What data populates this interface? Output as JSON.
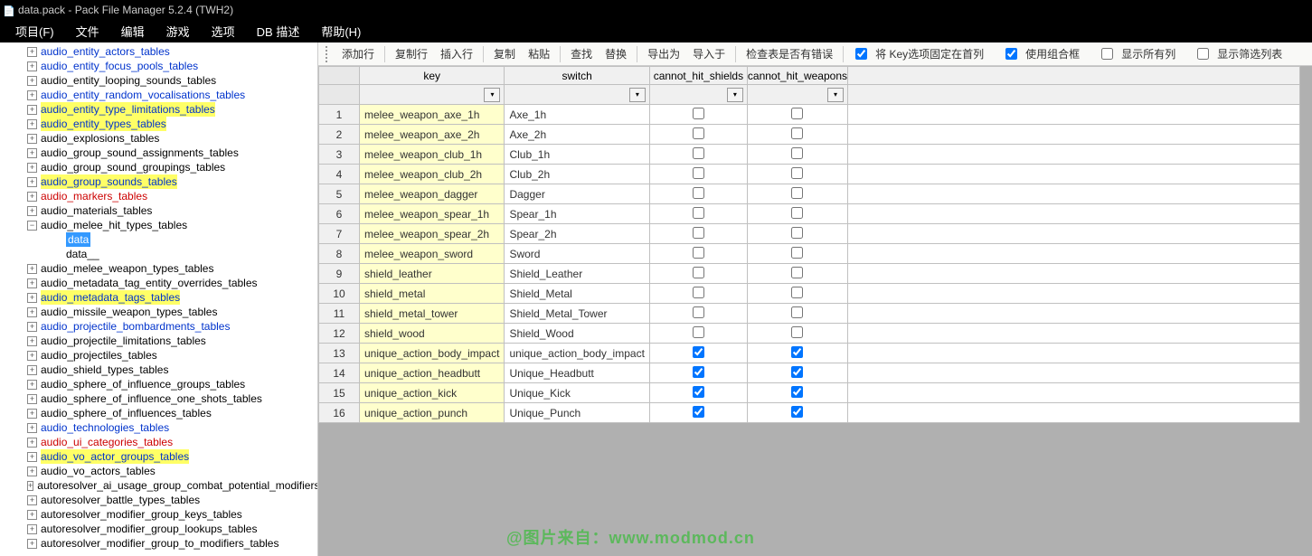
{
  "window": {
    "title": "data.pack - Pack File Manager 5.2.4 (TWH2)"
  },
  "menu": [
    "项目(F)",
    "文件",
    "编辑",
    "游戏",
    "选项",
    "DB 描述",
    "帮助(H)"
  ],
  "sidebar": {
    "items": [
      {
        "label": "audio_entity_actors_tables",
        "cls": "link-blue",
        "hl": false,
        "exp": true
      },
      {
        "label": "audio_entity_focus_pools_tables",
        "cls": "link-blue",
        "hl": false,
        "exp": true
      },
      {
        "label": "audio_entity_looping_sounds_tables",
        "cls": "link-black",
        "hl": false,
        "exp": true
      },
      {
        "label": "audio_entity_random_vocalisations_tables",
        "cls": "link-blue",
        "hl": false,
        "exp": true
      },
      {
        "label": "audio_entity_type_limitations_tables",
        "cls": "link-blue",
        "hl": true,
        "exp": true
      },
      {
        "label": "audio_entity_types_tables",
        "cls": "link-blue",
        "hl": true,
        "exp": true
      },
      {
        "label": "audio_explosions_tables",
        "cls": "link-black",
        "hl": false,
        "exp": true
      },
      {
        "label": "audio_group_sound_assignments_tables",
        "cls": "link-black",
        "hl": false,
        "exp": true
      },
      {
        "label": "audio_group_sound_groupings_tables",
        "cls": "link-black",
        "hl": false,
        "exp": true
      },
      {
        "label": "audio_group_sounds_tables",
        "cls": "link-blue",
        "hl": true,
        "exp": true
      },
      {
        "label": "audio_markers_tables",
        "cls": "link-red",
        "hl": false,
        "exp": true
      },
      {
        "label": "audio_materials_tables",
        "cls": "link-black",
        "hl": false,
        "exp": true
      },
      {
        "label": "audio_melee_hit_types_tables",
        "cls": "link-black",
        "hl": false,
        "exp": "open",
        "children": [
          {
            "label": "data",
            "selected": true
          },
          {
            "label": "data__",
            "selected": false
          }
        ]
      },
      {
        "label": "audio_melee_weapon_types_tables",
        "cls": "link-black",
        "hl": false,
        "exp": true
      },
      {
        "label": "audio_metadata_tag_entity_overrides_tables",
        "cls": "link-black",
        "hl": false,
        "exp": true
      },
      {
        "label": "audio_metadata_tags_tables",
        "cls": "link-blue",
        "hl": true,
        "exp": true
      },
      {
        "label": "audio_missile_weapon_types_tables",
        "cls": "link-black",
        "hl": false,
        "exp": true
      },
      {
        "label": "audio_projectile_bombardments_tables",
        "cls": "link-blue",
        "hl": false,
        "exp": true
      },
      {
        "label": "audio_projectile_limitations_tables",
        "cls": "link-black",
        "hl": false,
        "exp": true
      },
      {
        "label": "audio_projectiles_tables",
        "cls": "link-black",
        "hl": false,
        "exp": true
      },
      {
        "label": "audio_shield_types_tables",
        "cls": "link-black",
        "hl": false,
        "exp": true
      },
      {
        "label": "audio_sphere_of_influence_groups_tables",
        "cls": "link-black",
        "hl": false,
        "exp": true
      },
      {
        "label": "audio_sphere_of_influence_one_shots_tables",
        "cls": "link-black",
        "hl": false,
        "exp": true
      },
      {
        "label": "audio_sphere_of_influences_tables",
        "cls": "link-black",
        "hl": false,
        "exp": true
      },
      {
        "label": "audio_technologies_tables",
        "cls": "link-blue",
        "hl": false,
        "exp": true
      },
      {
        "label": "audio_ui_categories_tables",
        "cls": "link-red",
        "hl": false,
        "exp": true
      },
      {
        "label": "audio_vo_actor_groups_tables",
        "cls": "link-blue",
        "hl": true,
        "exp": true
      },
      {
        "label": "audio_vo_actors_tables",
        "cls": "link-black",
        "hl": false,
        "exp": true
      },
      {
        "label": "autoresolver_ai_usage_group_combat_potential_modifiers",
        "cls": "link-black",
        "hl": false,
        "exp": true
      },
      {
        "label": "autoresolver_battle_types_tables",
        "cls": "link-black",
        "hl": false,
        "exp": true
      },
      {
        "label": "autoresolver_modifier_group_keys_tables",
        "cls": "link-black",
        "hl": false,
        "exp": true
      },
      {
        "label": "autoresolver_modifier_group_lookups_tables",
        "cls": "link-black",
        "hl": false,
        "exp": true
      },
      {
        "label": "autoresolver_modifier_group_to_modifiers_tables",
        "cls": "link-black",
        "hl": false,
        "exp": true
      }
    ]
  },
  "toolbar": {
    "buttons": [
      "添加行",
      "复制行",
      "插入行",
      "复制",
      "粘贴",
      "查找",
      "替换",
      "导出为",
      "导入于",
      "检查表是否有错误"
    ],
    "checks": [
      {
        "label": "将 Key选项固定在首列",
        "checked": true
      },
      {
        "label": "使用组合框",
        "checked": true
      },
      {
        "label": "显示所有列",
        "checked": false
      },
      {
        "label": "显示筛选列表",
        "checked": false
      }
    ]
  },
  "grid": {
    "columns": [
      "key",
      "switch",
      "cannot_hit_shields",
      "cannot_hit_weapons"
    ],
    "rows": [
      {
        "n": 1,
        "key": "melee_weapon_axe_1h",
        "switch": "Axe_1h",
        "s": false,
        "w": false
      },
      {
        "n": 2,
        "key": "melee_weapon_axe_2h",
        "switch": "Axe_2h",
        "s": false,
        "w": false
      },
      {
        "n": 3,
        "key": "melee_weapon_club_1h",
        "switch": "Club_1h",
        "s": false,
        "w": false
      },
      {
        "n": 4,
        "key": "melee_weapon_club_2h",
        "switch": "Club_2h",
        "s": false,
        "w": false
      },
      {
        "n": 5,
        "key": "melee_weapon_dagger",
        "switch": "Dagger",
        "s": false,
        "w": false
      },
      {
        "n": 6,
        "key": "melee_weapon_spear_1h",
        "switch": "Spear_1h",
        "s": false,
        "w": false
      },
      {
        "n": 7,
        "key": "melee_weapon_spear_2h",
        "switch": "Spear_2h",
        "s": false,
        "w": false
      },
      {
        "n": 8,
        "key": "melee_weapon_sword",
        "switch": "Sword",
        "s": false,
        "w": false
      },
      {
        "n": 9,
        "key": "shield_leather",
        "switch": "Shield_Leather",
        "s": false,
        "w": false
      },
      {
        "n": 10,
        "key": "shield_metal",
        "switch": "Shield_Metal",
        "s": false,
        "w": false
      },
      {
        "n": 11,
        "key": "shield_metal_tower",
        "switch": "Shield_Metal_Tower",
        "s": false,
        "w": false
      },
      {
        "n": 12,
        "key": "shield_wood",
        "switch": "Shield_Wood",
        "s": false,
        "w": false
      },
      {
        "n": 13,
        "key": "unique_action_body_impact",
        "switch": "unique_action_body_impact",
        "s": true,
        "w": true
      },
      {
        "n": 14,
        "key": "unique_action_headbutt",
        "switch": "Unique_Headbutt",
        "s": true,
        "w": true
      },
      {
        "n": 15,
        "key": "unique_action_kick",
        "switch": "Unique_Kick",
        "s": true,
        "w": true
      },
      {
        "n": 16,
        "key": "unique_action_punch",
        "switch": "Unique_Punch",
        "s": true,
        "w": true
      }
    ]
  },
  "watermark": "@图片来自：www.modmod.cn"
}
